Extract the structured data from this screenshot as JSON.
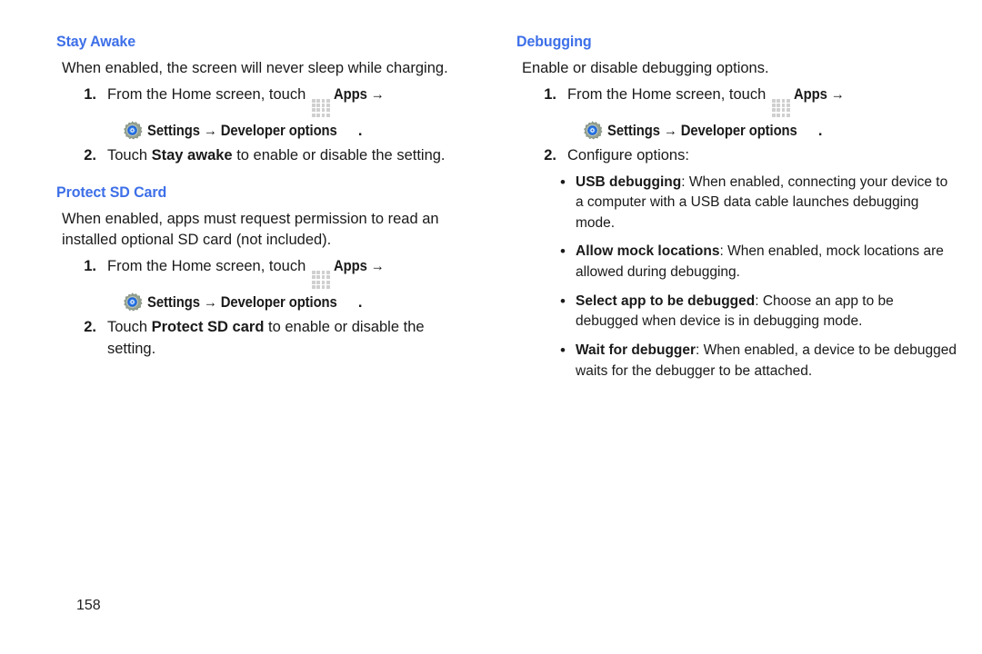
{
  "page": {
    "number": "158",
    "heading_color": "#3D6FE8"
  },
  "icons": {
    "apps": "apps-grid-icon",
    "settings": "settings-gear-icon",
    "arrow": "→",
    "bullet": "•"
  },
  "left_column": {
    "sections": [
      {
        "heading": "Stay Awake",
        "intro": "When enabled, the screen will never sleep while charging.",
        "steps": [
          {
            "number": "1.",
            "line1_pre": "From the Home screen, touch ",
            "line1_ui": "Apps →",
            "line2_ui": "Settings → Developer options",
            "line2_post": "."
          },
          {
            "number": "2.",
            "pre": "Touch ",
            "bold": "Stay awake",
            "post": " to enable or disable the setting."
          }
        ]
      },
      {
        "heading": "Protect SD Card",
        "intro": "When enabled, apps must request permission to read an installed optional SD card (not included).",
        "steps": [
          {
            "number": "1.",
            "line1_pre": "From the Home screen, touch ",
            "line1_ui": "Apps →",
            "line2_ui": "Settings → Developer options",
            "line2_post": "."
          },
          {
            "number": "2.",
            "pre": "Touch ",
            "bold": "Protect SD card",
            "post": " to enable or disable the setting."
          }
        ]
      }
    ]
  },
  "right_column": {
    "sections": [
      {
        "heading": "Debugging",
        "intro": "Enable or disable debugging options.",
        "steps": [
          {
            "number": "1.",
            "line1_pre": "From the Home screen, touch ",
            "line1_ui": "Apps →",
            "line2_ui": "Settings → Developer options",
            "line2_post": "."
          },
          {
            "number": "2.",
            "plain": "Configure options:"
          }
        ],
        "bullets": [
          {
            "term": "USB debugging",
            "text": ": When enabled, connecting your device to a computer with a USB data cable launches debugging mode."
          },
          {
            "term": "Allow mock locations",
            "text": ": When enabled, mock locations are allowed during debugging."
          },
          {
            "term": "Select app to be debugged",
            "text": ": Choose an app to be debugged when device is in debugging mode."
          },
          {
            "term": "Wait for debugger",
            "text": ": When enabled, a device to be debugged waits for the debugger to be attached."
          }
        ]
      }
    ]
  }
}
